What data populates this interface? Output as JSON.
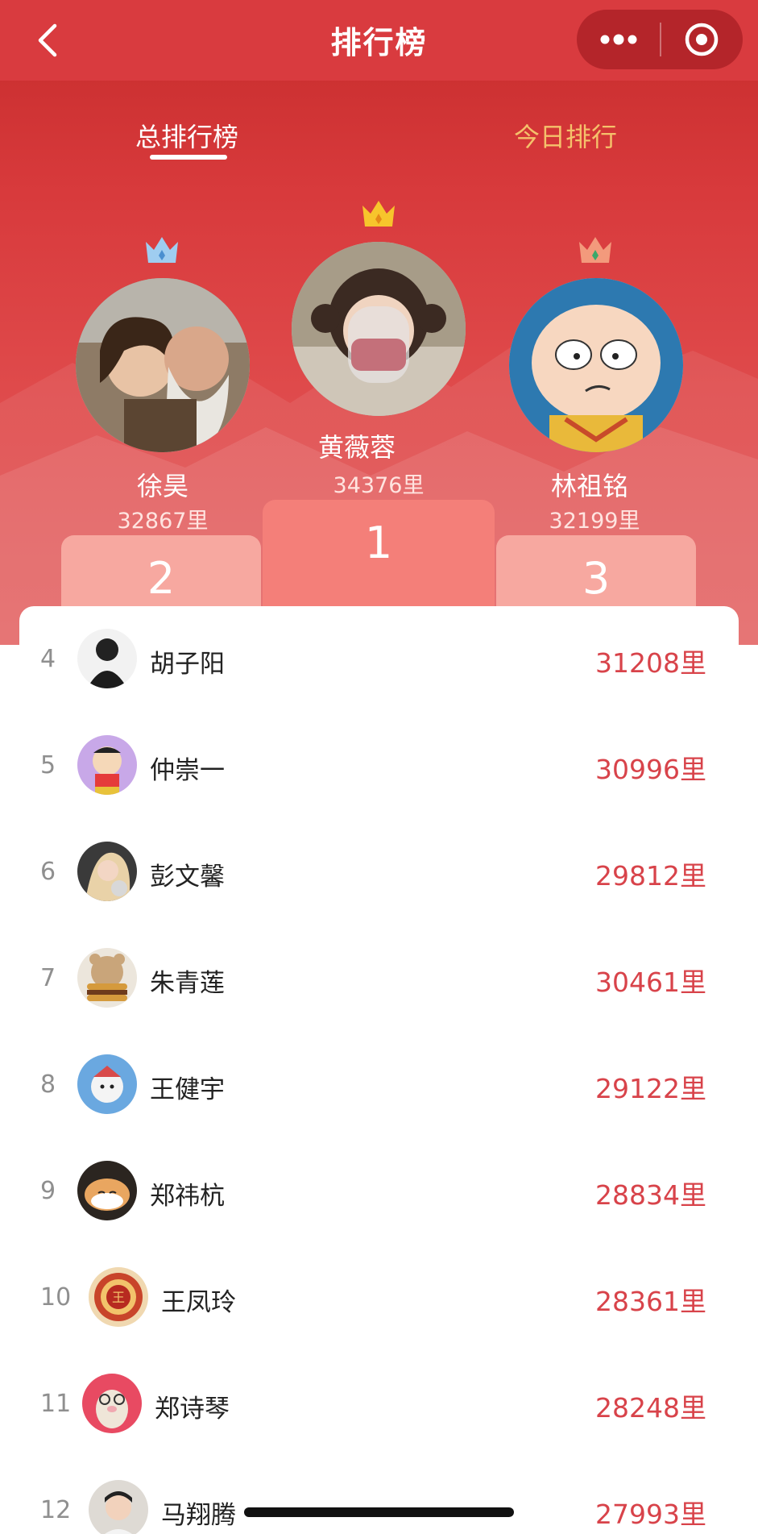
{
  "navbar": {
    "title": "排行榜"
  },
  "tabs": [
    {
      "label": "总排行榜",
      "active": true
    },
    {
      "label": "今日排行",
      "active": false
    }
  ],
  "colors": {
    "header_red": "#d93b3f",
    "score_red": "#d8434a",
    "tab_inactive": "#f5c16b",
    "podium_side": "#f7a8a0",
    "podium_center": "#f47f79"
  },
  "podium": [
    {
      "rank": "2",
      "name": "徐昊",
      "score": "32867里",
      "crown": "blue-crown-icon"
    },
    {
      "rank": "1",
      "name": "黄薇蓉",
      "score": "34376里",
      "crown": "gold-crown-icon"
    },
    {
      "rank": "3",
      "name": "林祖铭",
      "score": "32199里",
      "crown": "orange-crown-icon"
    }
  ],
  "list": [
    {
      "rank": "4",
      "name": "胡子阳",
      "score": "31208里"
    },
    {
      "rank": "5",
      "name": "仲崇一",
      "score": "30996里"
    },
    {
      "rank": "6",
      "name": "彭文馨",
      "score": "29812里"
    },
    {
      "rank": "7",
      "name": "朱青莲",
      "score": "30461里"
    },
    {
      "rank": "8",
      "name": "王健宇",
      "score": "29122里"
    },
    {
      "rank": "9",
      "name": "郑祎杭",
      "score": "28834里"
    },
    {
      "rank": "10",
      "name": "王凤玲",
      "score": "28361里"
    },
    {
      "rank": "11",
      "name": "郑诗琴",
      "score": "28248里"
    },
    {
      "rank": "12",
      "name": "马翔腾",
      "score": "27993里"
    }
  ]
}
